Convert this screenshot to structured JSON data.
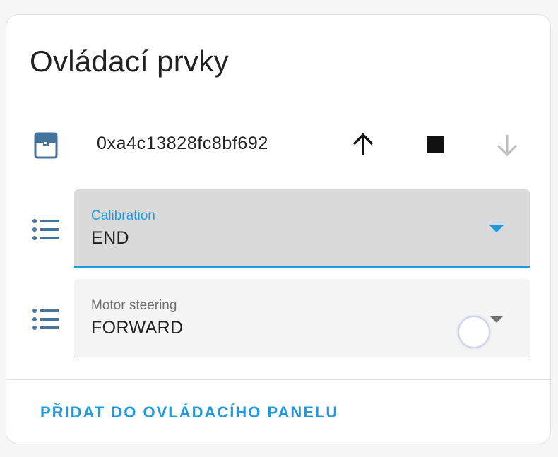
{
  "card": {
    "title": "Ovládací prvky",
    "entity": {
      "icon": "blind-cover-icon",
      "name": "0xa4c13828fc8bf692",
      "controls": [
        {
          "name": "open-button",
          "icon": "arrow-up-icon",
          "enabled": true
        },
        {
          "name": "stop-button",
          "icon": "stop-square-icon",
          "enabled": true
        },
        {
          "name": "close-button",
          "icon": "arrow-down-icon",
          "enabled": false
        }
      ]
    },
    "selects": [
      {
        "icon": "format-list-bulleted-icon",
        "label": "Calibration",
        "value": "END",
        "focused": true
      },
      {
        "icon": "format-list-bulleted-icon",
        "label": "Motor steering",
        "value": "FORWARD",
        "focused": false
      }
    ],
    "action_label": "PŘIDAT DO OVLÁDACÍHO PANELU"
  },
  "colors": {
    "accent": "#1e9ae0",
    "icon": "#44739e",
    "text": "#212121",
    "disabled": "#bdbdbd"
  }
}
